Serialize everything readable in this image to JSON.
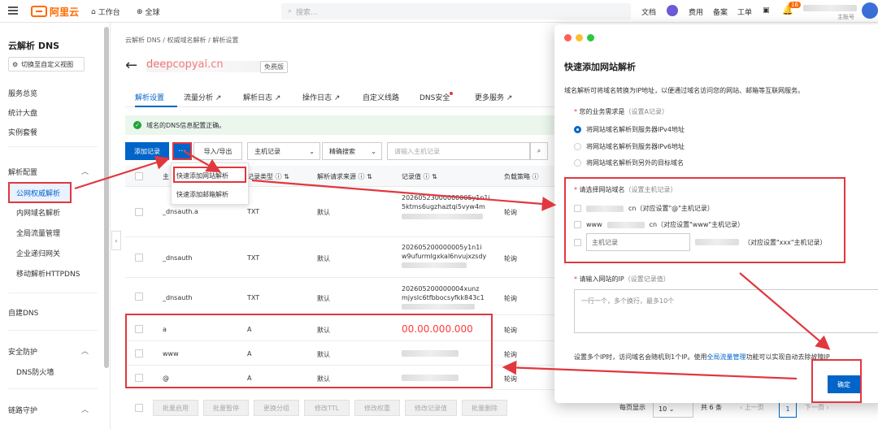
{
  "topbar": {
    "brand": "阿里云",
    "workbench": "工作台",
    "region": "全球",
    "search_placeholder": "搜索...",
    "docs": "文档",
    "fees": "费用",
    "filing": "备案",
    "tickets": "工单",
    "notif_count": "16",
    "account_role": "主账号"
  },
  "sidebar": {
    "title": "云解析 DNS",
    "switch_view": "切换至自定义视图",
    "overview": "服务总览",
    "dashboard": "统计大盘",
    "instances": "实例套餐",
    "group_config": "解析配置",
    "public_auth": "公网权威解析",
    "internal": "内网域名解析",
    "global_traffic": "全局流量管理",
    "enterprise_gw": "企业递归网关",
    "httpdns": "移动解析HTTPDNS",
    "self_dns": "自建DNS",
    "group_security": "安全防护",
    "dns_firewall": "DNS防火墙",
    "group_link": "链路守护"
  },
  "breadcrumb": [
    "云解析 DNS",
    "权威域名解析",
    "解析设置"
  ],
  "domain": {
    "name": "deepcopyai.cn",
    "tag": "免费版"
  },
  "tabs": [
    {
      "label": "解析设置",
      "ext": ""
    },
    {
      "label": "流量分析",
      "ext": "↗"
    },
    {
      "label": "解析日志",
      "ext": "↗"
    },
    {
      "label": "操作日志",
      "ext": "↗"
    },
    {
      "label": "自定义线路",
      "ext": ""
    },
    {
      "label": "DNS安全",
      "ext": ""
    },
    {
      "label": "更多服务",
      "ext": "↗"
    }
  ],
  "alert": "域名的DNS信息配置正确。",
  "toolbar": {
    "add_record": "添加记录",
    "more": "···",
    "import_export": "导入/导出",
    "filter_field": "主机记录",
    "match_mode": "精确搜索",
    "search_placeholder": "请输入主机记录"
  },
  "dropdown": {
    "quick_site": "快速添加网站解析",
    "quick_mail": "快速添加邮箱解析"
  },
  "table": {
    "headers": {
      "host": "主",
      "type": "记录类型",
      "source": "解析请求来源",
      "value": "记录值",
      "policy": "负载策略"
    },
    "rows": [
      {
        "host": "_dnsauth.a",
        "type": "TXT",
        "source": "默认",
        "value_lines": [
          "20260523000000005y1n1i",
          "5ktms6ugzhaztqi5vyw4m",
          ""
        ],
        "policy": "轮询"
      },
      {
        "host": "_dnsauth",
        "type": "TXT",
        "source": "默认",
        "value_lines": [
          "202605200000005y1n1i",
          "w9ufurmlgxkal6nvujxzsdy",
          ""
        ],
        "policy": "轮询"
      },
      {
        "host": "_dnsauth",
        "type": "TXT",
        "source": "默认",
        "value_lines": [
          "202605200000004xunz",
          "mjyslc6tfbbocsyfkk843c1",
          ""
        ],
        "policy": "轮询"
      },
      {
        "host": "a",
        "type": "A",
        "source": "默认",
        "value": "00.00.000.000",
        "policy": "轮询"
      },
      {
        "host": "www",
        "type": "A",
        "source": "默认",
        "value": "",
        "policy": "轮询"
      },
      {
        "host": "@",
        "type": "A",
        "source": "默认",
        "value": "",
        "policy": "轮询"
      }
    ]
  },
  "bottom_actions": [
    "批量启用",
    "批量暂停",
    "更换分组",
    "修改TTL",
    "修改权重",
    "修改记录值",
    "批量删除"
  ],
  "pager": {
    "per_page_label": "每页显示",
    "per_page": "10",
    "total": "共 6 条",
    "prev": "上一页",
    "current": "1",
    "next": "下一页"
  },
  "modal": {
    "title": "快速添加网站解析",
    "desc": "域名解析可将域名转换为IP地址，以便通过域名访问您的网站、邮箱等互联网服务。",
    "need_label": "您的业务需求是",
    "need_hint": "（设置A记录）",
    "opt1": "将网站域名解析到服务器IPv4地址",
    "opt2": "将网站域名解析到服务器IPv6地址",
    "opt3": "将网站域名解析到另外的目标域名",
    "choose_label": "请选择网站域名",
    "choose_hint": "（设置主机记录）",
    "row1_suffix": "cn（对应设置\"@\"主机记录）",
    "row2_prefix": "www",
    "row2_suffix": "cn（对应设置\"www\"主机记录）",
    "row3_placeholder": "主机记录",
    "row3_suffix": "（对应设置\"xxx\"主机记录）",
    "ip_label": "请输入网站的IP",
    "ip_hint": "（设置记录值）",
    "ip_placeholder": "一行一个，多个换行，最多10个",
    "foot_pre": "设置多个IP时，访问域名会随机到1个IP。使用",
    "foot_link": "全局流量管理",
    "foot_post": "功能可以实现自动去除故障IP",
    "confirm": "确定"
  },
  "colors": {
    "primary": "#0064c8",
    "annotation_red": "#e0383e",
    "brand_orange": "#ff6a00"
  }
}
